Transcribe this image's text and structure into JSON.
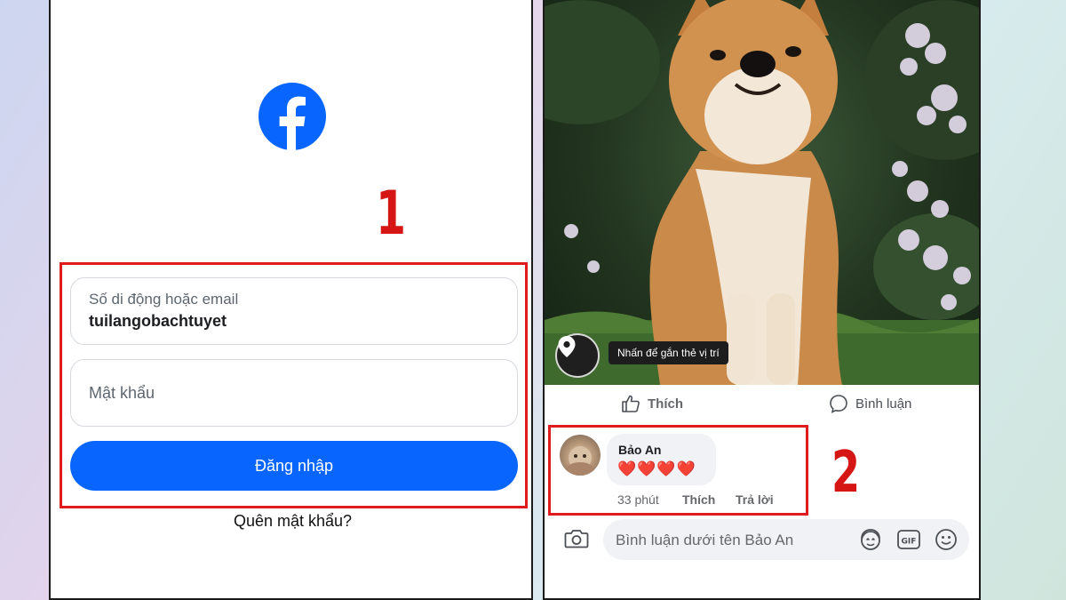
{
  "left_screen": {
    "step_number": "1",
    "logo_icon": "facebook-logo",
    "email_label": "Số di động hoặc email",
    "email_value": "tuilangobachtuyet",
    "password_placeholder": "Mật khẩu",
    "login_button": "Đăng nhập",
    "forgot_password": "Quên mật khẩu?"
  },
  "right_screen": {
    "location_tooltip": "Nhấn để gắn thẻ vị trí",
    "actions": {
      "like": "Thích",
      "comment": "Bình luận"
    },
    "comment": {
      "author": "Bảo An",
      "text": "❤️❤️❤️❤️",
      "time": "33 phút",
      "like": "Thích",
      "reply": "Trả lời"
    },
    "step_number": "2",
    "composer_placeholder": "Bình luận dưới tên Bảo An",
    "composer_icons": [
      "camera-icon",
      "avatar-sticker-icon",
      "gif-icon",
      "emoji-icon"
    ]
  },
  "colors": {
    "facebook_blue": "#0866ff",
    "highlight_red": "#e01b1b",
    "step_number_red": "#d61515"
  }
}
